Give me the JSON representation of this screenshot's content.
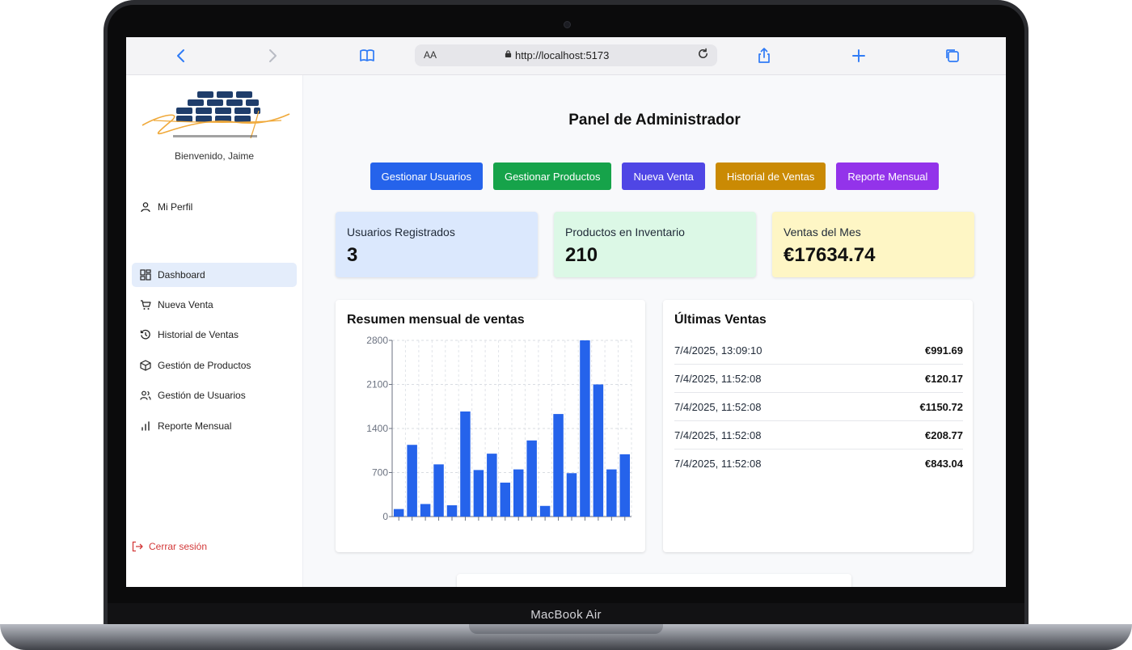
{
  "device": {
    "label": "MacBook Air"
  },
  "browser": {
    "aa": "AA",
    "url": "http://localhost:5173"
  },
  "sidebar": {
    "welcome": "Bienvenido, Jaime",
    "items": [
      {
        "label": "Mi Perfil",
        "icon": "user-icon"
      },
      {
        "label": "Dashboard",
        "icon": "dashboard-icon"
      },
      {
        "label": "Nueva Venta",
        "icon": "cart-icon"
      },
      {
        "label": "Historial de Ventas",
        "icon": "history-icon"
      },
      {
        "label": "Gestión de Productos",
        "icon": "package-icon"
      },
      {
        "label": "Gestión de Usuarios",
        "icon": "users-icon"
      },
      {
        "label": "Reporte Mensual",
        "icon": "bar-chart-icon"
      }
    ],
    "logout": "Cerrar sesión"
  },
  "main": {
    "title": "Panel de Administrador",
    "actions": [
      {
        "label": "Gestionar Usuarios",
        "color": "#2563eb"
      },
      {
        "label": "Gestionar Productos",
        "color": "#16a34a"
      },
      {
        "label": "Nueva Venta",
        "color": "#4f46e5"
      },
      {
        "label": "Historial de Ventas",
        "color": "#ca8a04"
      },
      {
        "label": "Reporte Mensual",
        "color": "#9333ea"
      }
    ],
    "stats": [
      {
        "label": "Usuarios Registrados",
        "value": "3",
        "bg": "#dbe8fd"
      },
      {
        "label": "Productos en Inventario",
        "value": "210",
        "bg": "#dcf8e6"
      },
      {
        "label": "Ventas del Mes",
        "value": "€17634.74",
        "bg": "#fef6c5"
      }
    ],
    "chart_title": "Resumen mensual de ventas",
    "sales_title": "Últimas Ventas",
    "sales": [
      {
        "date": "7/4/2025, 13:09:10",
        "amount": "€991.69"
      },
      {
        "date": "7/4/2025, 11:52:08",
        "amount": "€120.17"
      },
      {
        "date": "7/4/2025, 11:52:08",
        "amount": "€1150.72"
      },
      {
        "date": "7/4/2025, 11:52:08",
        "amount": "€208.77"
      },
      {
        "date": "7/4/2025, 11:52:08",
        "amount": "€843.04"
      }
    ]
  },
  "chart_data": {
    "type": "bar",
    "ylim": [
      0,
      2800
    ],
    "yticks": [
      0,
      700,
      1400,
      2100,
      2800
    ],
    "values": [
      120,
      1140,
      200,
      830,
      180,
      1670,
      740,
      1000,
      540,
      750,
      1210,
      170,
      1630,
      690,
      2800,
      2100,
      750,
      990
    ],
    "grid": true,
    "color": "#2563eb"
  }
}
